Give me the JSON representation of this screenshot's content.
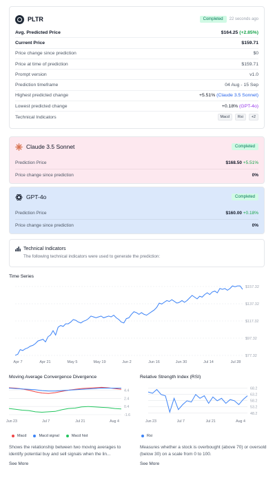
{
  "main": {
    "ticker": "PLTR",
    "status": "Completed",
    "ago": "22 seconds ago",
    "rows": [
      {
        "label": "Avg. Predicted Price",
        "value": "$164.25",
        "extra": "(+2.85%)"
      },
      {
        "label": "Current Price",
        "value": "$159.71"
      },
      {
        "label": "Price change since prediction",
        "value": "$0"
      },
      {
        "label": "Price at time of prediction",
        "value": "$159.71"
      },
      {
        "label": "Prompt version",
        "value": "v1.0"
      },
      {
        "label": "Prediction timeframe",
        "value": "04 Aug - 15 Sep"
      },
      {
        "label": "Highest predicted change",
        "value": "+5.51%",
        "extra": "(Claude 3.5 Sonnet)"
      },
      {
        "label": "Lowest predicted change",
        "value": "+0.18%",
        "extra": "(GPT-4o)"
      },
      {
        "label": "Technical Indicators",
        "pills": [
          "Macd",
          "Rsi",
          "+2"
        ]
      }
    ]
  },
  "claude": {
    "name": "Claude 3.5 Sonnet",
    "status": "Completed",
    "pred_label": "Prediction Price",
    "pred_value": "$168.50",
    "pred_change": "+5.51%",
    "since_label": "Price change since prediction",
    "since_value": "0%"
  },
  "gpt": {
    "name": "GPT-4o",
    "status": "Completed",
    "pred_label": "Prediction Price",
    "pred_value": "$160.00",
    "pred_change": "+0.18%",
    "since_label": "Price change since prediction",
    "since_value": "0%"
  },
  "tech": {
    "title": "Technical Indicators",
    "desc": "The following technical indicators were used to generate the prediction:"
  },
  "colors": {
    "line": "#3b82f6",
    "macd": "#ef4444",
    "signal": "#3b82f6",
    "hist": "#22c55e",
    "rsi": "#3b82f6"
  },
  "chart_data": [
    {
      "type": "line",
      "title": "Time Series",
      "x_ticks": [
        "Apr 7",
        "Apr 21",
        "May 5",
        "May 19",
        "Jun 2",
        "Jun 16",
        "Jun 30",
        "Jul 14",
        "Jul 28"
      ],
      "y_ticks": [
        "$157.32",
        "$137.32",
        "$117.32",
        "$97.32",
        "$77.32"
      ],
      "ylim": [
        77.32,
        157.32
      ],
      "series": [
        {
          "values": [
            77.5,
            78.5,
            84,
            83,
            85,
            86,
            88,
            89,
            91,
            94,
            95,
            96,
            93,
            99,
            101,
            106,
            101,
            110,
            112,
            111,
            114,
            114,
            116,
            119,
            118,
            116,
            115,
            117,
            118,
            120,
            123,
            122,
            121,
            122,
            123,
            121,
            122,
            123,
            122,
            124,
            121,
            119,
            116,
            115,
            120,
            121,
            125,
            128,
            127,
            125,
            127,
            125,
            124,
            126,
            128,
            130,
            133,
            138,
            137,
            139,
            141,
            140,
            142,
            140,
            138,
            139,
            141,
            139,
            141,
            144,
            147,
            145,
            143,
            146,
            145,
            148,
            150,
            148,
            151,
            152,
            150,
            155,
            154,
            155,
            153,
            155,
            158,
            157,
            158,
            158,
            154
          ]
        }
      ]
    },
    {
      "type": "line",
      "title": "Moving Average Convergence Divergence",
      "x_ticks": [
        "Jun 23",
        "Jul 7",
        "Jul 21",
        "Aug 4"
      ],
      "y_ticks": [
        "4.4",
        "2.4",
        "0.4",
        "-1.6"
      ],
      "ylim": [
        -1.6,
        5.5
      ],
      "series": [
        {
          "name": "Macd",
          "values": [
            5.0,
            4.9,
            4.7,
            4.4,
            4.0,
            3.7,
            3.6,
            3.8,
            4.1,
            4.4,
            4.6,
            4.8,
            4.9,
            5.0,
            5.1,
            5.0,
            4.8,
            4.6
          ]
        },
        {
          "name": "Macd signal",
          "values": [
            4.9,
            4.8,
            4.7,
            4.6,
            4.5,
            4.3,
            4.2,
            4.2,
            4.3,
            4.4,
            4.5,
            4.6,
            4.7,
            4.8,
            4.9,
            4.9,
            4.9,
            4.9
          ]
        },
        {
          "name": "Macd hist",
          "values": [
            -0.1,
            -0.3,
            -0.5,
            -0.6,
            -0.9,
            -1.0,
            -0.9,
            -0.8,
            -0.4,
            -0.1,
            0.0,
            0.3,
            0.4,
            0.3,
            0.2,
            0.1,
            -0.1,
            -0.2
          ]
        }
      ]
    },
    {
      "type": "line",
      "title": "Relative Strength Index (RSI)",
      "x_ticks": [
        "Jun 23",
        "Jul 7",
        "Jul 21",
        "Aug 4"
      ],
      "y_ticks": [
        "68.2",
        "63.2",
        "58.2",
        "53.2",
        "48.2"
      ],
      "ylim": [
        47,
        70
      ],
      "series": [
        {
          "name": "Rsi",
          "values": [
            65,
            64,
            67,
            63,
            62,
            49,
            60,
            51,
            55,
            58,
            57,
            63,
            60,
            62,
            56,
            61,
            58,
            60,
            56,
            59,
            58,
            55,
            59,
            62
          ]
        }
      ]
    }
  ],
  "macd_desc": "Shows the relationship between two moving averages to identify potential buy and sell signals when the lin...",
  "rsi_desc": "Measures whether a stock is overbought (above 70) or oversold (below 30) on a scale from 0 to 100.",
  "see_more": "See More"
}
